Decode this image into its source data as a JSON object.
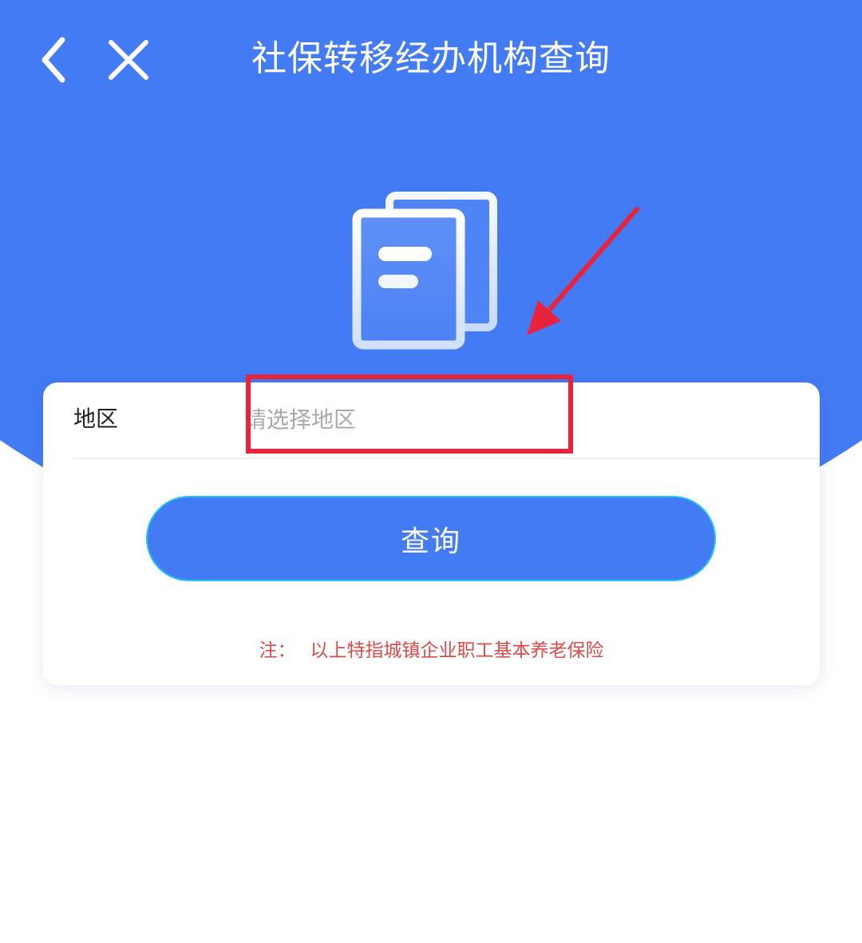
{
  "header": {
    "title": "社保转移经办机构查询",
    "back_icon": "chevron-left-icon",
    "close_icon": "close-icon"
  },
  "hero": {
    "icon": "document-stack-icon"
  },
  "form": {
    "region_label": "地区",
    "region_value": "",
    "region_placeholder": "请选择地区"
  },
  "actions": {
    "query_label": "查询"
  },
  "note": {
    "label": "注：",
    "text": "以上特指城镇企业职工基本养老保险"
  },
  "annotation": {
    "box_color": "#e8233e",
    "arrow_color": "#e8233e"
  },
  "colors": {
    "primary": "#437bf5",
    "button_border": "#25c3ee",
    "note_text": "#dd4a4a"
  }
}
